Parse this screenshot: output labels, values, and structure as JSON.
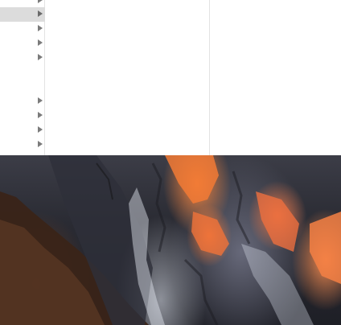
{
  "finder": {
    "column1": {
      "rows": [
        {
          "label": "",
          "selected": false,
          "has_children": true
        },
        {
          "label": "",
          "selected": true,
          "has_children": true
        },
        {
          "label": "",
          "selected": false,
          "has_children": true
        },
        {
          "label": "",
          "selected": false,
          "has_children": true
        },
        {
          "label": "",
          "selected": false,
          "has_children": true
        },
        {
          "label": "",
          "selected": false,
          "has_children": false
        },
        {
          "label": "",
          "selected": false,
          "has_children": false
        },
        {
          "label": "",
          "selected": false,
          "has_children": true
        },
        {
          "label": "",
          "selected": false,
          "has_children": true
        },
        {
          "label": "",
          "selected": false,
          "has_children": true
        },
        {
          "label": "",
          "selected": false,
          "has_children": true
        }
      ]
    }
  },
  "icons": {
    "disclosure": "chevron-right-icon"
  },
  "colors": {
    "selection": "#dcdcdc",
    "disclosure_arrow": "#7b7b7b",
    "column_divider": "#e3e3e3"
  }
}
